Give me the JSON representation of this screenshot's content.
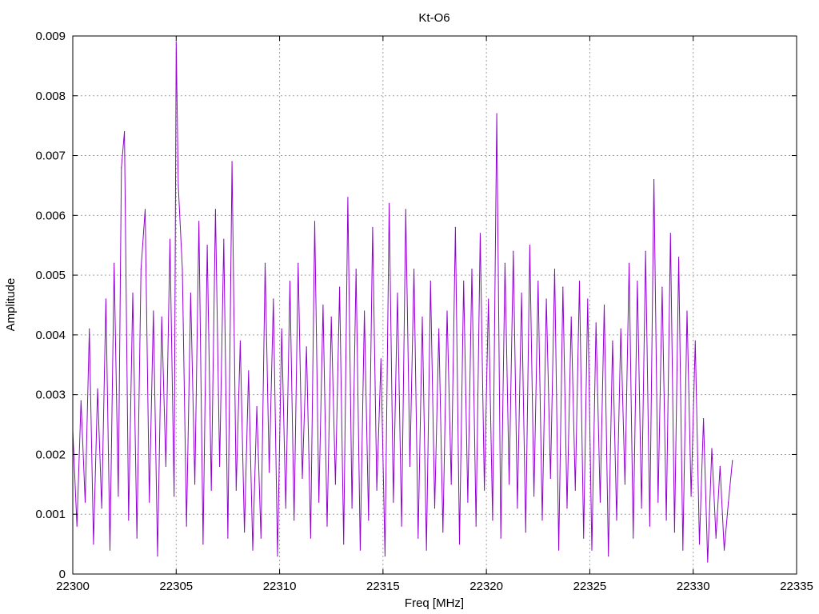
{
  "chart_data": {
    "type": "line",
    "title": "Kt-O6",
    "xlabel": "Freq [MHz]",
    "ylabel": "Amplitude",
    "xlim": [
      22300,
      22335
    ],
    "ylim": [
      0,
      0.009
    ],
    "x_ticks": [
      22300,
      22305,
      22310,
      22315,
      22320,
      22325,
      22330,
      22335
    ],
    "x_tick_labels": [
      "22300",
      "22305",
      "22310",
      "22315",
      "22320",
      "22325",
      "22330",
      "22335"
    ],
    "y_ticks": [
      0,
      0.001,
      0.002,
      0.003,
      0.004,
      0.005,
      0.006,
      0.007,
      0.008,
      0.009
    ],
    "y_tick_labels": [
      "0",
      "0.001",
      "0.002",
      "0.003",
      "0.004",
      "0.005",
      "0.006",
      "0.007",
      "0.008",
      "0.009"
    ],
    "grid": true,
    "series": [
      {
        "color": "#9400d3",
        "x": [
          22300.0,
          22300.2,
          22300.4,
          22300.6,
          22300.8,
          22301.0,
          22301.2,
          22301.4,
          22301.6,
          22301.8,
          22302.0,
          22302.2,
          22302.35,
          22302.5,
          22302.7,
          22302.9,
          22303.1,
          22303.3,
          22303.5,
          22303.7,
          22303.9,
          22304.1,
          22304.3,
          22304.5,
          22304.7,
          22304.9,
          22305.0,
          22305.1,
          22305.3,
          22305.5,
          22305.7,
          22305.9,
          22306.1,
          22306.3,
          22306.5,
          22306.7,
          22306.9,
          22307.1,
          22307.3,
          22307.5,
          22307.7,
          22307.9,
          22308.1,
          22308.3,
          22308.5,
          22308.7,
          22308.9,
          22309.1,
          22309.3,
          22309.5,
          22309.7,
          22309.9,
          22310.1,
          22310.3,
          22310.5,
          22310.7,
          22310.9,
          22311.1,
          22311.3,
          22311.5,
          22311.7,
          22311.9,
          22312.1,
          22312.3,
          22312.5,
          22312.7,
          22312.9,
          22313.1,
          22313.3,
          22313.5,
          22313.7,
          22313.9,
          22314.1,
          22314.3,
          22314.5,
          22314.7,
          22314.9,
          22315.1,
          22315.3,
          22315.5,
          22315.7,
          22315.9,
          22316.1,
          22316.3,
          22316.5,
          22316.7,
          22316.9,
          22317.1,
          22317.3,
          22317.5,
          22317.7,
          22317.9,
          22318.1,
          22318.3,
          22318.5,
          22318.7,
          22318.9,
          22319.1,
          22319.3,
          22319.5,
          22319.7,
          22319.9,
          22320.1,
          22320.3,
          22320.5,
          22320.7,
          22320.9,
          22321.1,
          22321.3,
          22321.5,
          22321.7,
          22321.9,
          22322.1,
          22322.3,
          22322.5,
          22322.7,
          22322.9,
          22323.1,
          22323.3,
          22323.5,
          22323.7,
          22323.9,
          22324.1,
          22324.3,
          22324.5,
          22324.7,
          22324.9,
          22325.1,
          22325.3,
          22325.5,
          22325.7,
          22325.9,
          22326.1,
          22326.3,
          22326.5,
          22326.7,
          22326.9,
          22327.1,
          22327.3,
          22327.5,
          22327.7,
          22327.9,
          22328.1,
          22328.3,
          22328.5,
          22328.7,
          22328.9,
          22329.1,
          22329.3,
          22329.5,
          22329.7,
          22329.9,
          22330.1,
          22330.3,
          22330.5,
          22330.7,
          22330.9,
          22331.1,
          22331.3,
          22331.5,
          22331.7,
          22331.9
        ],
        "y": [
          0.0024,
          0.0008,
          0.0029,
          0.0012,
          0.0041,
          0.0005,
          0.0031,
          0.0011,
          0.0046,
          0.0004,
          0.0052,
          0.0013,
          0.0068,
          0.0074,
          0.0009,
          0.0047,
          0.0006,
          0.0051,
          0.0061,
          0.0012,
          0.0044,
          0.0003,
          0.0043,
          0.0018,
          0.0056,
          0.0013,
          0.0089,
          0.0065,
          0.0051,
          0.0008,
          0.0047,
          0.0015,
          0.0059,
          0.0005,
          0.0055,
          0.0014,
          0.0061,
          0.0018,
          0.0056,
          0.0006,
          0.0069,
          0.0014,
          0.0039,
          0.0007,
          0.0034,
          0.0004,
          0.0028,
          0.0006,
          0.0052,
          0.0017,
          0.0046,
          0.0003,
          0.0041,
          0.0011,
          0.0049,
          0.0009,
          0.0052,
          0.0016,
          0.0038,
          0.0006,
          0.0059,
          0.0012,
          0.0045,
          0.0008,
          0.0043,
          0.0015,
          0.0048,
          0.0005,
          0.0063,
          0.0011,
          0.0051,
          0.0004,
          0.0044,
          0.0009,
          0.0058,
          0.0014,
          0.0036,
          0.0003,
          0.0062,
          0.0012,
          0.0047,
          0.0008,
          0.0061,
          0.0018,
          0.0051,
          0.0006,
          0.0043,
          0.0004,
          0.0049,
          0.0011,
          0.0041,
          0.0007,
          0.0044,
          0.0015,
          0.0058,
          0.0005,
          0.0049,
          0.0012,
          0.0051,
          0.0008,
          0.0057,
          0.0014,
          0.0046,
          0.0009,
          0.0077,
          0.0006,
          0.0052,
          0.0015,
          0.0054,
          0.0011,
          0.0047,
          0.0007,
          0.0055,
          0.0013,
          0.0049,
          0.0009,
          0.0046,
          0.0016,
          0.0051,
          0.0004,
          0.0048,
          0.0011,
          0.0043,
          0.0014,
          0.0049,
          0.0006,
          0.0046,
          0.0004,
          0.0042,
          0.0012,
          0.0045,
          0.0003,
          0.0039,
          0.0009,
          0.0041,
          0.0015,
          0.0052,
          0.0006,
          0.0049,
          0.0011,
          0.0054,
          0.0008,
          0.0066,
          0.0012,
          0.0048,
          0.0009,
          0.0057,
          0.0007,
          0.0053,
          0.0004,
          0.0044,
          0.0013,
          0.0039,
          0.0005,
          0.0026,
          0.0002,
          0.0021,
          0.0006,
          0.0018,
          0.0004,
          0.0012,
          0.0019
        ]
      }
    ]
  }
}
